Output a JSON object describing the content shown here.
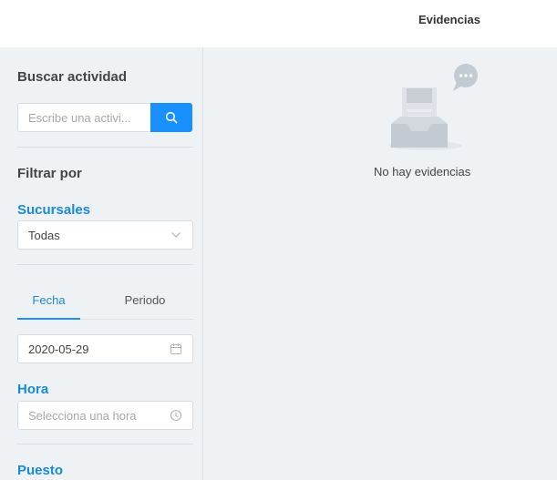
{
  "header": {
    "title": "Evidencias"
  },
  "sidebar": {
    "search": {
      "heading": "Buscar actividad",
      "placeholder": "Escribe una activi...",
      "button_icon": "search-icon"
    },
    "filter_heading": "Filtrar por",
    "branches": {
      "label": "Sucursales",
      "selected": "Todas"
    },
    "tabs": [
      {
        "label": "Fecha",
        "active": true
      },
      {
        "label": "Periodo",
        "active": false
      }
    ],
    "date": {
      "value": "2020-05-29",
      "icon": "calendar-icon"
    },
    "hour": {
      "label": "Hora",
      "placeholder": "Selecciona una hora",
      "icon": "clock-icon"
    },
    "position": {
      "label": "Puesto"
    }
  },
  "main": {
    "empty_text": "No hay evidencias",
    "empty_icon": "empty-inbox-icon"
  },
  "colors": {
    "accent": "#1890ff",
    "heading_blue": "#1a8ad6",
    "background": "#eff2f5"
  }
}
